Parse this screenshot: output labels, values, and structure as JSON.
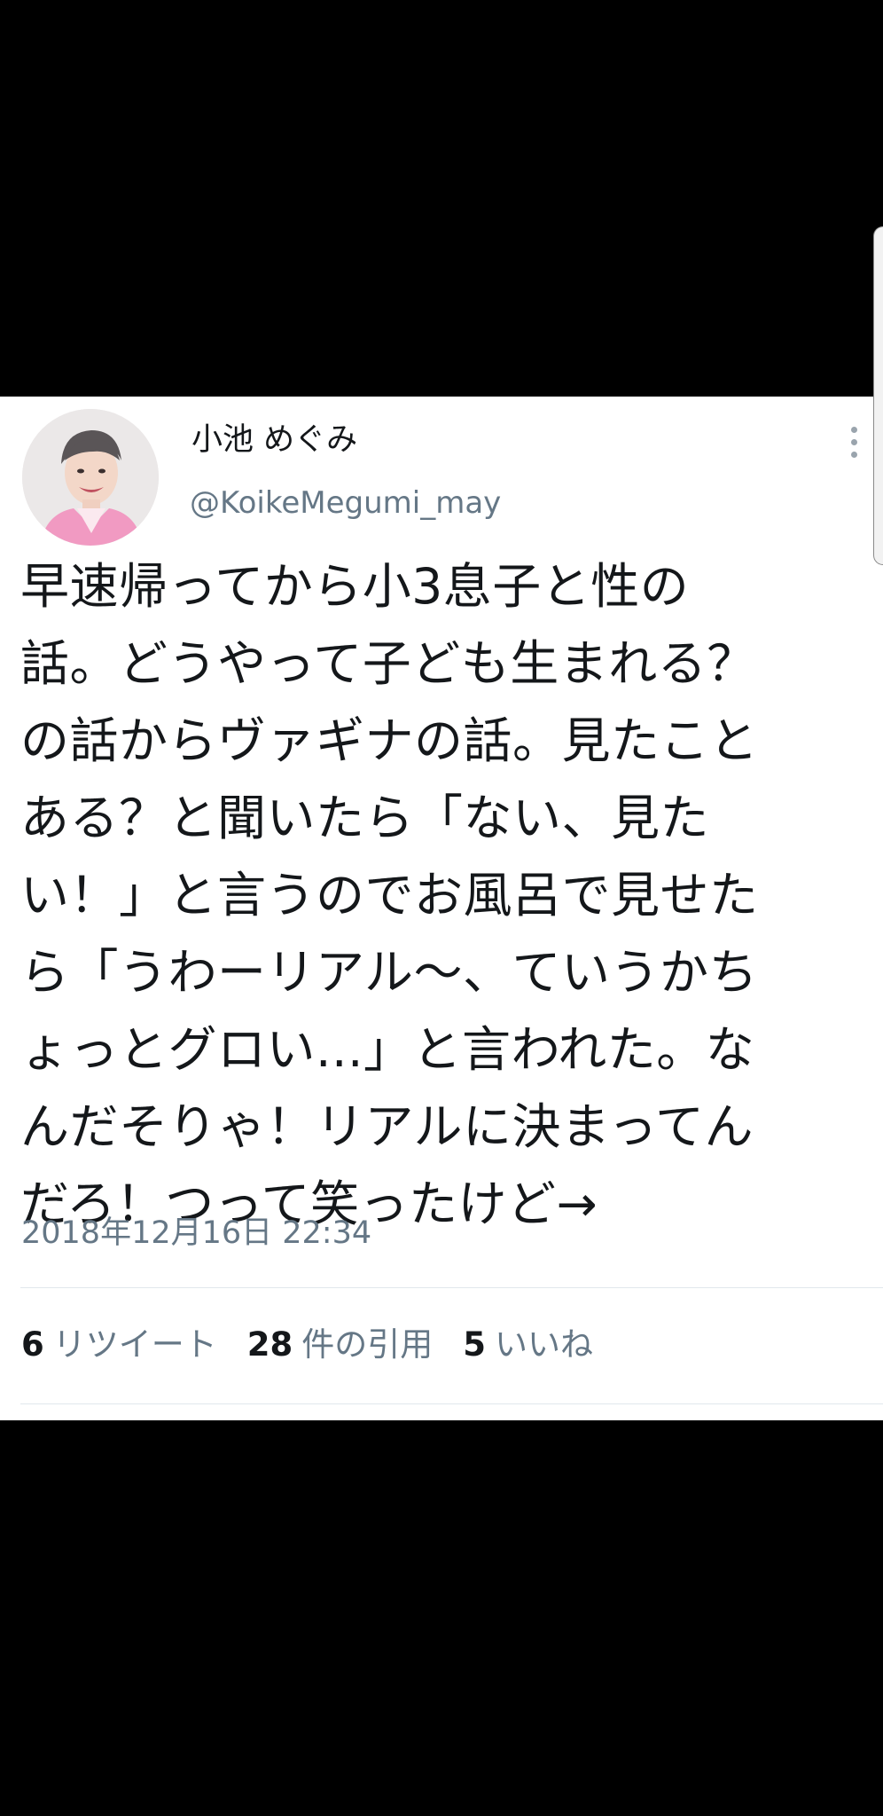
{
  "tweet": {
    "display_name": "小池 めぐみ",
    "handle": "@KoikeMegumi_may",
    "text_lines": [
      "早速帰ってから小3息子と性の",
      "話。どうやって子ども生まれる？",
      "の話からヴァギナの話。見たこと",
      "ある？と聞いたら「ない、見た",
      "い！」と言うのでお風呂で見せた",
      "ら「うわーリアル〜、ていうかち",
      "ょっとグロい...」と言われた。な",
      "んだそりゃ！リアルに決まってん",
      "だろ！つって笑ったけど→"
    ],
    "timestamp": "2018年12月16日 22:34",
    "stats": {
      "retweets": {
        "count": "6",
        "label": "リツイート"
      },
      "quotes": {
        "count": "28",
        "label": "件の引用"
      },
      "likes": {
        "count": "5",
        "label": "いいね"
      }
    }
  },
  "icons": {
    "more": "more-vertical-icon",
    "avatar": "profile-avatar"
  },
  "colors": {
    "background": "#000000",
    "card": "#ffffff",
    "primary_text": "#14171a",
    "secondary_text": "#657786",
    "divider": "#e1e8ed"
  }
}
